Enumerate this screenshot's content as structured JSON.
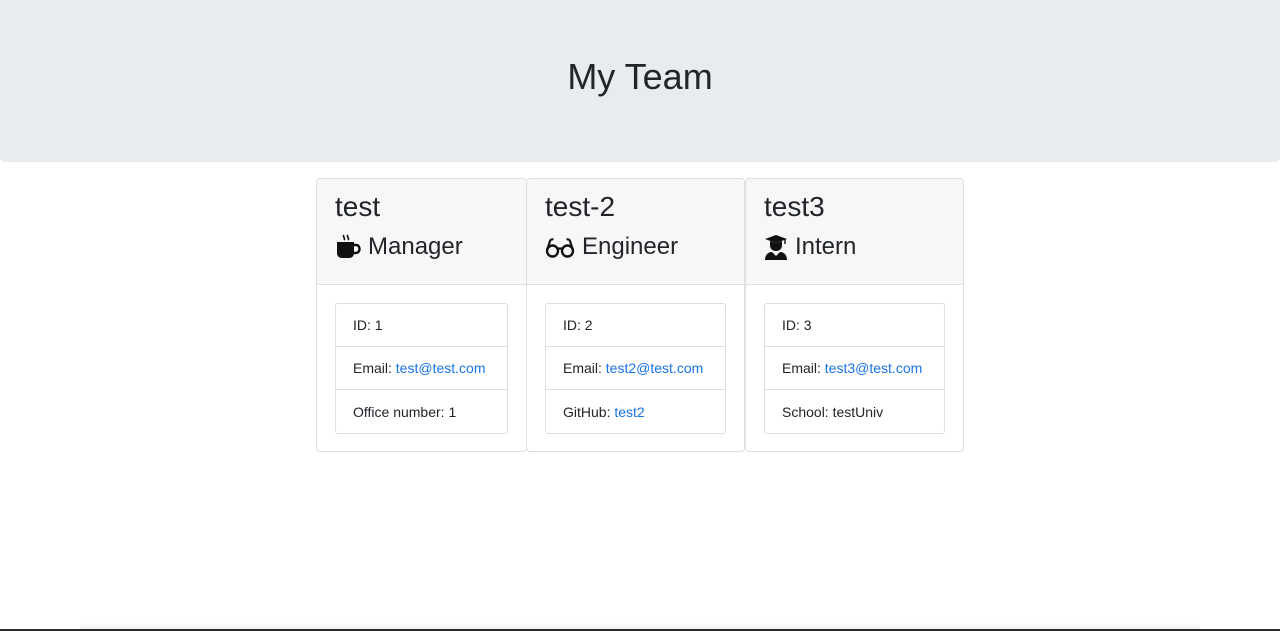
{
  "header": {
    "title": "My Team"
  },
  "cards": [
    {
      "name": "test",
      "role": "Manager",
      "role_icon": "coffee-mug-icon",
      "items": [
        {
          "label": "ID: ",
          "value": "1"
        },
        {
          "label": "Email: ",
          "value": "test@test.com"
        },
        {
          "label": "Office number: ",
          "value": "1"
        }
      ]
    },
    {
      "name": "test-2",
      "role": "Engineer",
      "role_icon": "glasses-icon",
      "items": [
        {
          "label": "ID: ",
          "value": "2"
        },
        {
          "label": "Email: ",
          "value": "test2@test.com"
        },
        {
          "label": "GitHub: ",
          "value": "test2"
        }
      ]
    },
    {
      "name": "test3",
      "role": "Intern",
      "role_icon": "graduate-icon",
      "items": [
        {
          "label": "ID: ",
          "value": "3"
        },
        {
          "label": "Email: ",
          "value": "test3@test.com"
        },
        {
          "label": "School: ",
          "value": "testUniv"
        }
      ]
    }
  ],
  "colors": {
    "link": "#1a73e8",
    "header_bg": "#e9ecef",
    "card_header_bg": "#f7f7f7"
  }
}
